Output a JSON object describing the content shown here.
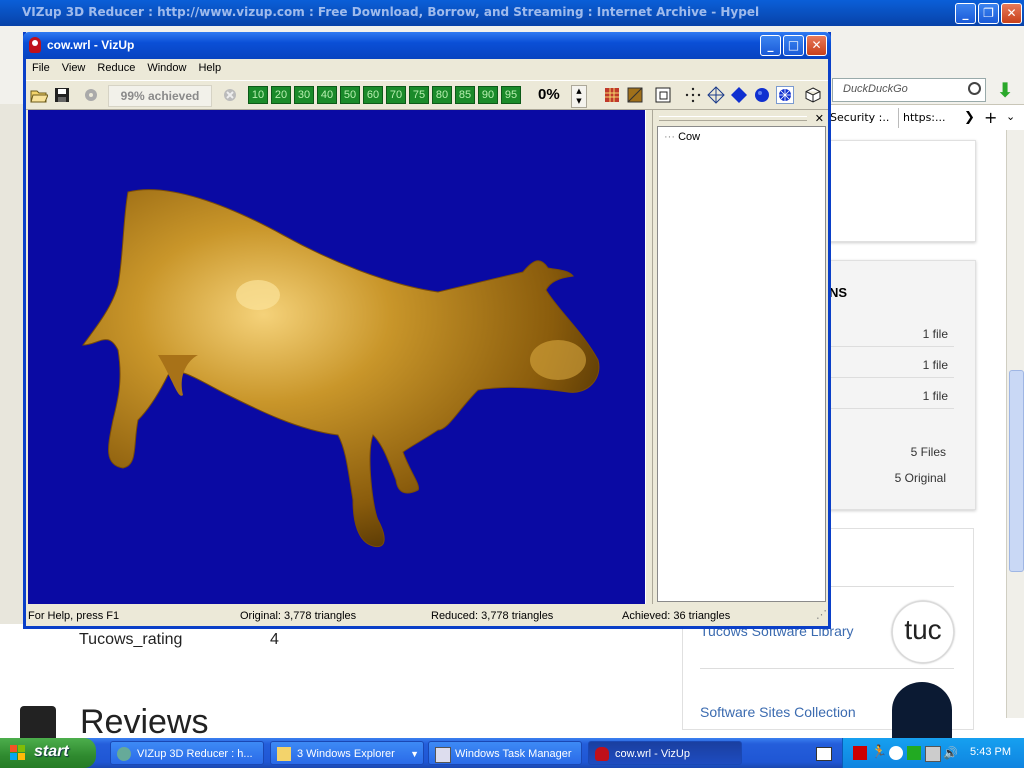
{
  "background_browser": {
    "title": "VIZup 3D Reducer : http://www.vizup.com : Free Download, Borrow, and Streaming : Internet Archive - Hypel",
    "search_placeholder": "DuckDuckGo",
    "tabs": [
      "Security :...",
      "https:..."
    ],
    "file_rows": [
      "1 file",
      "1 file",
      "1 file"
    ],
    "files_total": "5 Files",
    "files_original": "5 Original",
    "section_heading_fragment": "NS",
    "tucows_rating_label": "Tucows_rating",
    "tucows_rating_value": "4",
    "reviews_heading": "Reviews",
    "collections": [
      "Tucows Software Library",
      "Software Sites Collection"
    ]
  },
  "vizup": {
    "title": "cow.wrl - VizUp",
    "menu": [
      "File",
      "View",
      "Reduce",
      "Window",
      "Help"
    ],
    "achieved_label": "99% achieved",
    "percent_buttons": [
      "10",
      "20",
      "30",
      "40",
      "50",
      "60",
      "70",
      "75",
      "80",
      "85",
      "90",
      "95"
    ],
    "current_percent": "0%",
    "tree_root": "Cow",
    "status": {
      "help": "For Help, press F1",
      "original": "Original: 3,778 triangles",
      "reduced": "Reduced: 3,778 triangles",
      "achieved": "Achieved: 36 triangles"
    },
    "model_color": "#b8861e",
    "viewport_color": "#0a0aa3"
  },
  "taskbar": {
    "start_label": "start",
    "tasks": [
      "VIZup 3D Reducer : h...",
      "3 Windows Explorer",
      "Windows Task Manager",
      "cow.wrl - VizUp"
    ],
    "clock": "5:43 PM"
  }
}
